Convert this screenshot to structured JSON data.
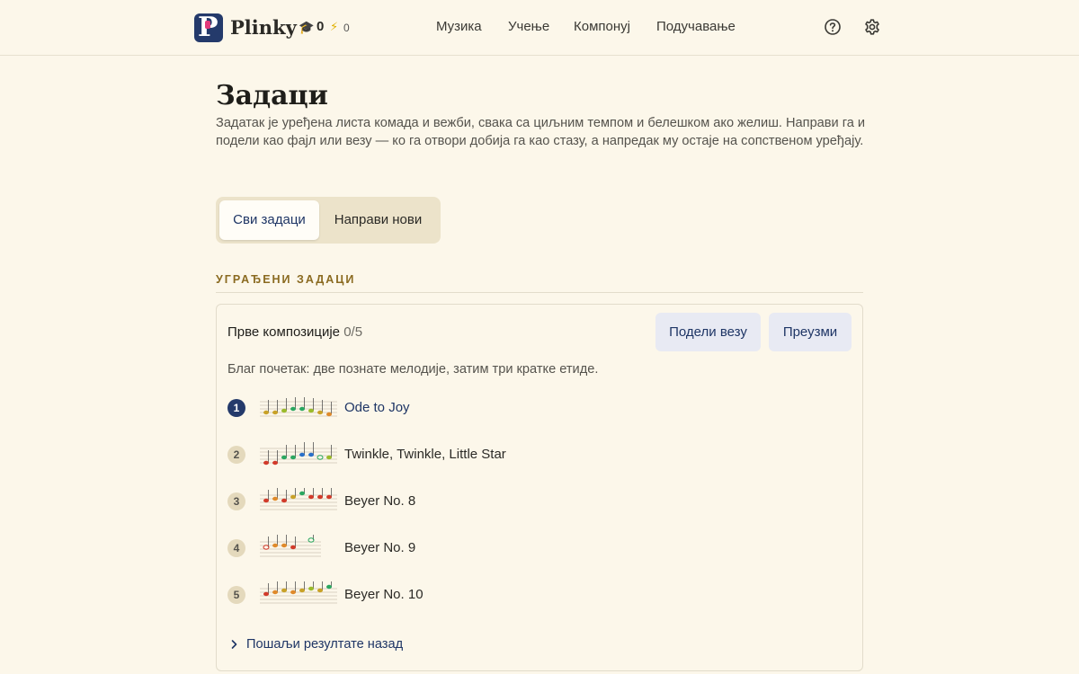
{
  "app": {
    "brand": "Plinky",
    "stats": {
      "xp_value": "0",
      "streak_value": "0"
    }
  },
  "nav": {
    "links": [
      "Музика",
      "Учење",
      "Компонуј",
      "Подучавање"
    ]
  },
  "header": {
    "title": "Задаци",
    "description": "Задатак је уређена листа комада и вежби, свака са циљним темпом и белешком ако желиш. Направи га и подели као фајл или везу — ко га отвори добија га као стазу, а напредак му остаје на сопственом уређају."
  },
  "tabs": [
    "Сви задаци",
    "Направи нови"
  ],
  "section": {
    "label": "УГРАЂЕНИ ЗАДАЦИ"
  },
  "assignment": {
    "title": "Прве композиције",
    "progress": "0/5",
    "share_label": "Подели везу",
    "download_label": "Преузми",
    "description": "Благ почетак: две познате мелодије, затим три кратке етиде.",
    "items": [
      {
        "number": "1",
        "title": "Ode to Joy"
      },
      {
        "number": "2",
        "title": "Twinkle, Twinkle, Little Star"
      },
      {
        "number": "3",
        "title": "Beyer No. 8"
      },
      {
        "number": "4",
        "title": "Beyer No. 9"
      },
      {
        "number": "5",
        "title": "Beyer No. 10"
      }
    ],
    "send_back_label": "Пошаљи резултате назад"
  },
  "colors": {
    "accent": "#243a6b",
    "background": "#fcf7ea",
    "section_label": "#8a6a20",
    "button_bg": "#e8eaf3"
  },
  "icons": [
    "graduation-cap-icon",
    "lightning-icon",
    "help-circle-icon",
    "gear-icon",
    "chevron-right-icon"
  ]
}
